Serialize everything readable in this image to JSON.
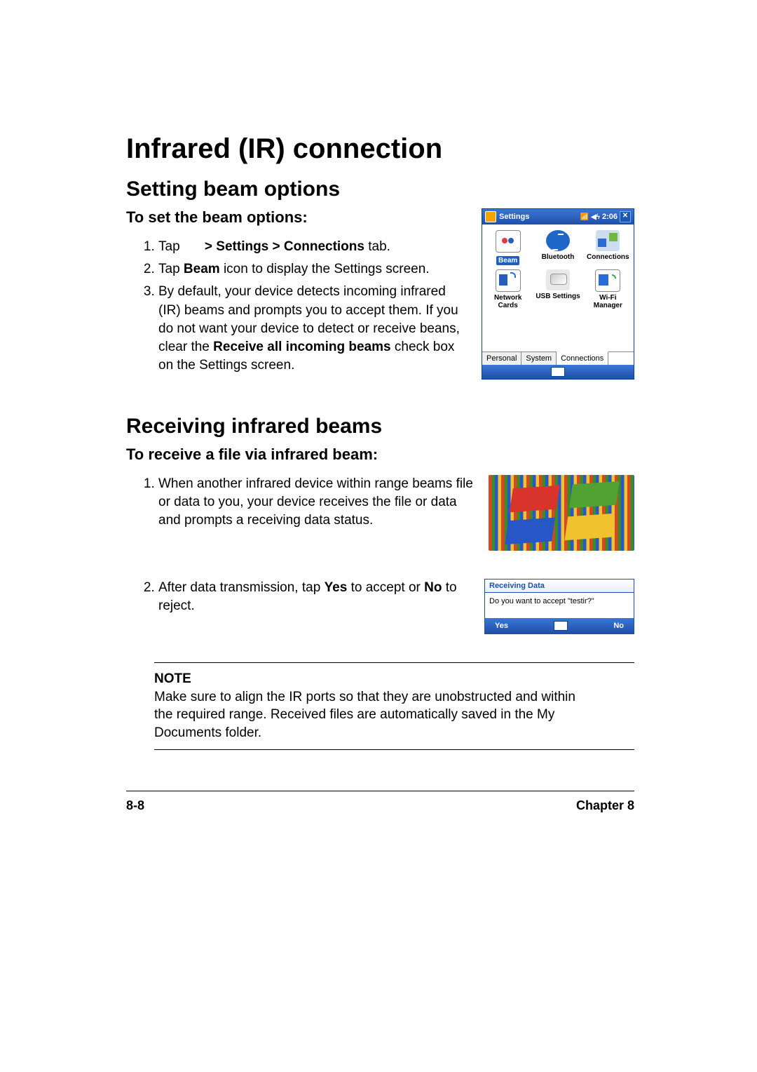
{
  "h1": "Infrared (IR) connection",
  "sec1": {
    "h2": "Setting beam options",
    "h3": "To set the beam options:",
    "steps": [
      {
        "pre": "Tap ",
        "mid": "",
        "bold": "> Settings > Connections",
        "post": " tab."
      },
      {
        "pre": "Tap ",
        "bold": "Beam",
        "post": " icon to display the Settings screen."
      },
      {
        "pre": "By default, your device detects incoming infrared (IR) beams and prompts you to accept them. If you do not want your device to detect or receive beans, clear the ",
        "bold": "Receive all incoming beams",
        "post": " check box on the Settings screen."
      }
    ]
  },
  "ss1": {
    "title": "Settings",
    "time": "2:06",
    "icons": [
      {
        "label": "Beam",
        "selected": true
      },
      {
        "label": "Bluetooth"
      },
      {
        "label": "Connections"
      },
      {
        "label": "Network Cards"
      },
      {
        "label": "USB Settings"
      },
      {
        "label": "Wi-Fi Manager"
      }
    ],
    "tabs": [
      "Personal",
      "System",
      "Connections"
    ]
  },
  "sec2": {
    "h2": "Receiving infrared beams",
    "h3": "To receive a file via infrared beam:",
    "step1": "When another infrared device within range beams file or data to you, your device receives the file or data and prompts a receiving data status.",
    "step2": {
      "pre": "After data transmission, tap ",
      "b1": "Yes",
      "mid": " to accept or ",
      "b2": "No",
      "post": " to reject."
    }
  },
  "ss3": {
    "title": "Receiving Data",
    "body": "Do you want to accept \"testir?\"",
    "yes": "Yes",
    "no": "No"
  },
  "note": {
    "label": "NOTE",
    "text": "Make sure to align the IR ports so that they are unobstructed and within the required range.  Received files are automatically saved in the My Documents folder."
  },
  "footer": {
    "left": "8-8",
    "right": "Chapter 8"
  }
}
